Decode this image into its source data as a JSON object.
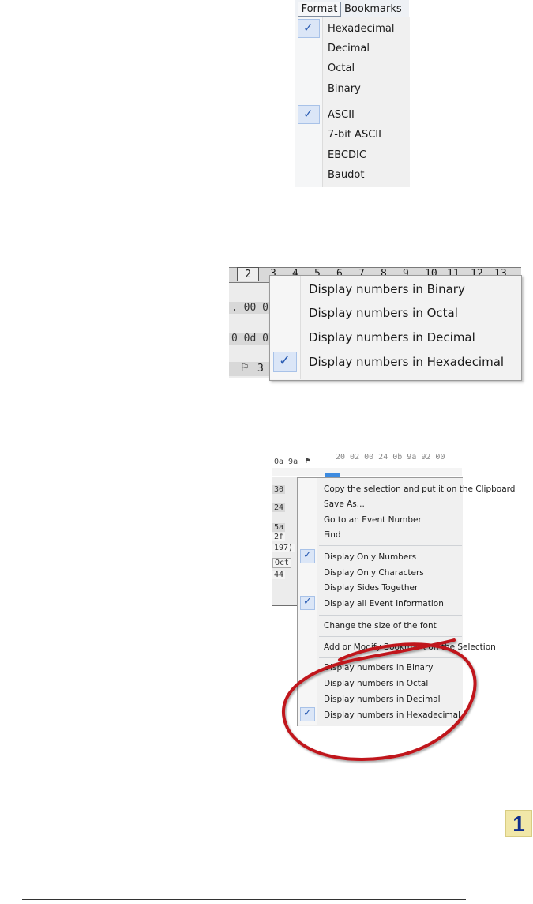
{
  "panel1": {
    "menubar": {
      "format": "Format",
      "bookmarks": "Bookmarks"
    },
    "items": [
      {
        "label": "Hexadecimal",
        "checked": true
      },
      {
        "label": "Decimal",
        "checked": false
      },
      {
        "label": "Octal",
        "checked": false
      },
      {
        "label": "Binary",
        "checked": false
      },
      {
        "label": "ASCII",
        "checked": true
      },
      {
        "label": "7-bit ASCII",
        "checked": false
      },
      {
        "label": "EBCDIC",
        "checked": false
      },
      {
        "label": "Baudot",
        "checked": false
      }
    ]
  },
  "panel2": {
    "header_cols": [
      "2",
      "3",
      "4",
      "5",
      "6",
      "7",
      "8",
      "9",
      "10",
      "11",
      "12",
      "13"
    ],
    "hex_rows": [
      ". 00 0",
      "0 0d 0",
      "3"
    ],
    "items": [
      {
        "label": "Display numbers in Binary",
        "checked": false
      },
      {
        "label": "Display numbers in Octal",
        "checked": false
      },
      {
        "label": "Display numbers in Decimal",
        "checked": false
      },
      {
        "label": "Display numbers in Hexadecimal",
        "checked": true
      }
    ]
  },
  "panel3": {
    "top_row": "0a 9a",
    "top_row_right": "20 02 00 24 0b 9a 92 00",
    "left_cells": [
      "30",
      "24",
      "5a",
      "2f",
      "197)",
      "Oct",
      "44"
    ],
    "items": [
      {
        "label": "Copy the selection and put it on the Clipboard",
        "checked": false
      },
      {
        "label": "Save As...",
        "checked": false
      },
      {
        "label": "Go to an Event Number",
        "checked": false
      },
      {
        "label": "Find",
        "checked": false
      },
      {
        "label": "Display Only Numbers",
        "checked": true
      },
      {
        "label": "Display Only Characters",
        "checked": false
      },
      {
        "label": "Display Sides Together",
        "checked": false
      },
      {
        "label": "Display all Event Information",
        "checked": true
      },
      {
        "label": "Change the size of the font",
        "checked": false
      },
      {
        "label": "Add or Modify Bookmark on the Selection",
        "checked": false
      },
      {
        "label": "Display numbers in Binary",
        "checked": false
      },
      {
        "label": "Display numbers in Octal",
        "checked": false
      },
      {
        "label": "Display numbers in Decimal",
        "checked": false
      },
      {
        "label": "Display numbers in Hexadecimal",
        "checked": true
      }
    ]
  },
  "badge": {
    "number": "1"
  },
  "colors": {
    "check": "#2a5cb3",
    "highlight": "#dbe6f7",
    "annotation": "#c0141a",
    "badge_bg": "#f1e7a8",
    "badge_text": "#0f2c8c"
  }
}
